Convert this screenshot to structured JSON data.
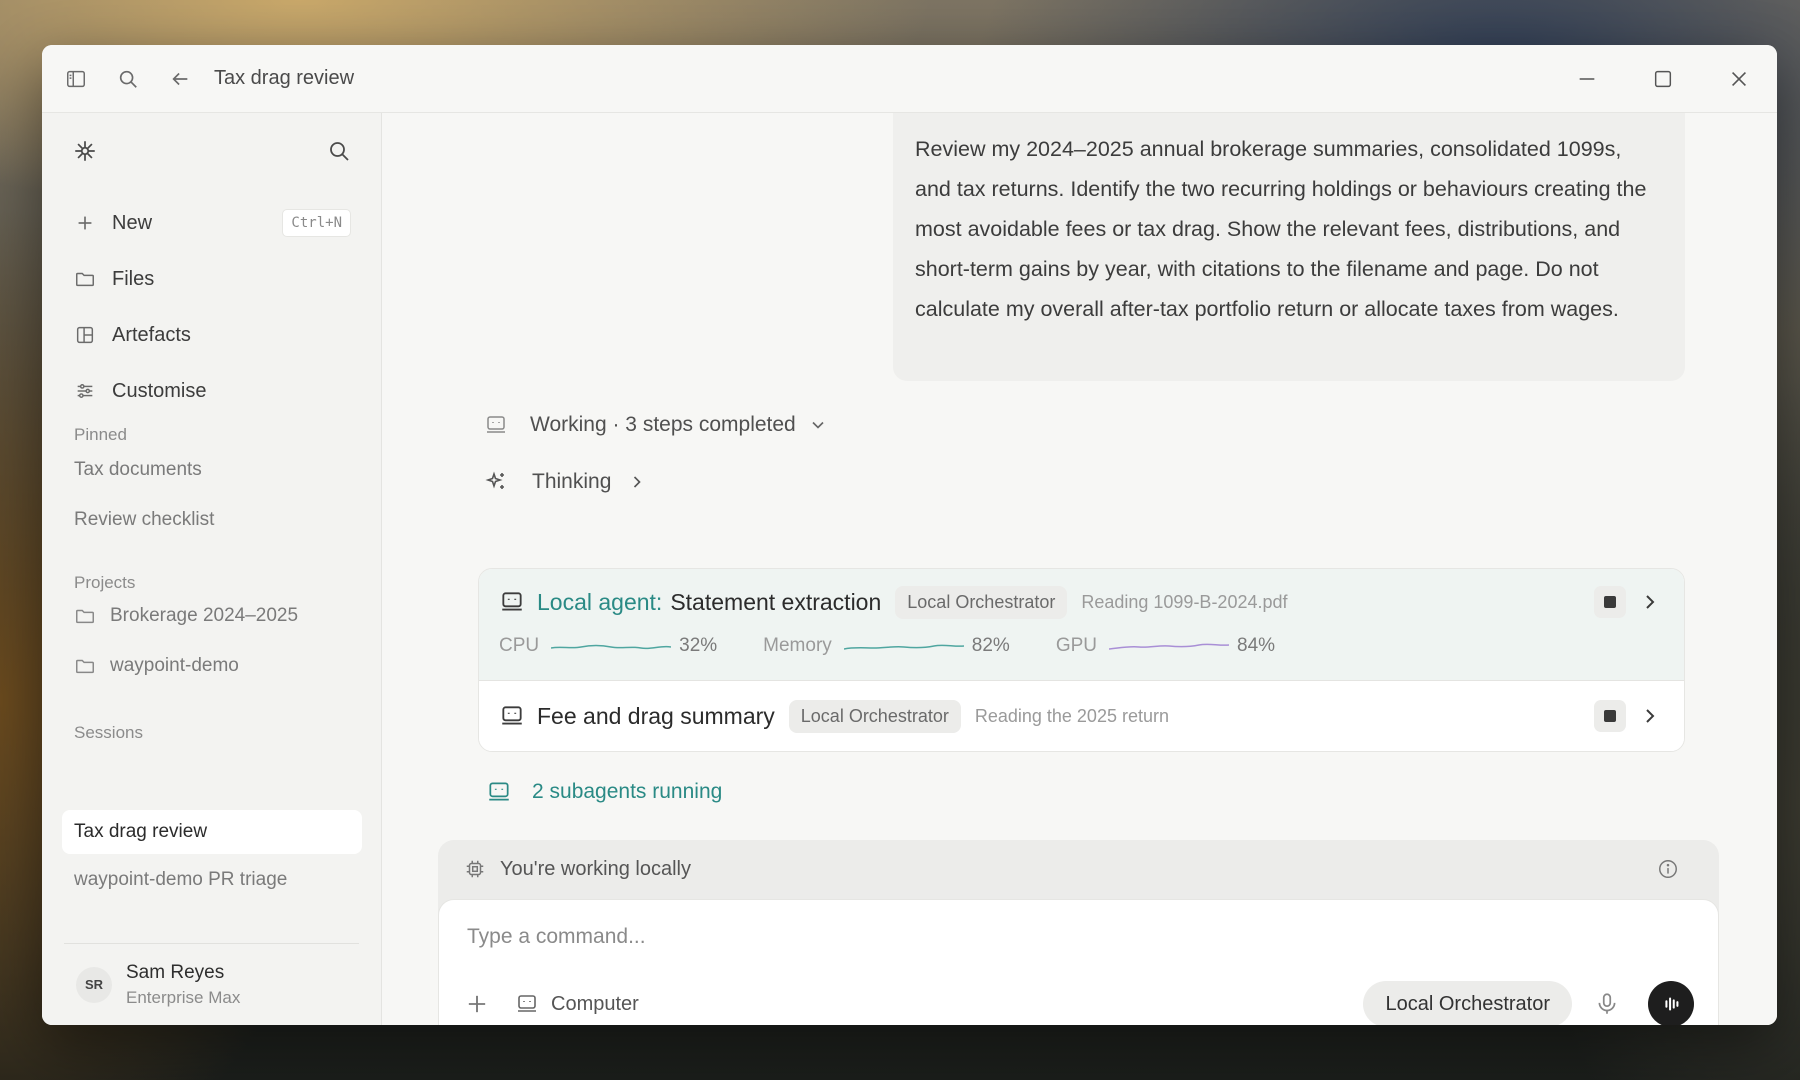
{
  "titlebar": {
    "title": "Tax drag review",
    "icons": [
      "sidebar-toggle-icon",
      "search-icon",
      "back-arrow-icon"
    ],
    "controls": [
      "minimize-icon",
      "maximize-icon",
      "close-icon"
    ]
  },
  "sidebar": {
    "nav": [
      {
        "label": "New",
        "icon": "plus-icon",
        "shortcut": "Ctrl+N"
      },
      {
        "label": "Files",
        "icon": "folder-icon"
      },
      {
        "label": "Artefacts",
        "icon": "artefacts-icon"
      },
      {
        "label": "Customise",
        "icon": "sliders-icon"
      }
    ],
    "pinned_label": "Pinned",
    "pinned": [
      "Tax documents",
      "Review checklist"
    ],
    "projects_label": "Projects",
    "projects": [
      "Brokerage 2024–2025",
      "waypoint-demo"
    ],
    "sessions_label": "Sessions",
    "sessions": [
      "Tax drag review",
      "waypoint-demo PR triage"
    ],
    "user": {
      "initials": "SR",
      "name": "Sam Reyes",
      "plan": "Enterprise Max"
    }
  },
  "main": {
    "user_message": "Review my 2024–2025 annual brokerage summaries, consolidated 1099s, and tax returns. Identify the two recurring holdings or behaviours creating the most avoidable fees or tax drag. Show the relevant fees, distributions, and short-term gains by year, with citations to the filename and page. Do not calculate my overall after-tax portfolio return or allocate taxes from wages.",
    "working_status": "Working · 3 steps completed",
    "thinking_label": "Thinking",
    "tasks": [
      {
        "prefix": "Local agent:",
        "title": "Statement extraction",
        "chip": "Local Orchestrator",
        "status": "Reading 1099-B-2024.pdf",
        "metrics": [
          {
            "label": "CPU",
            "value": "32%",
            "color": "#4fa6a0"
          },
          {
            "label": "Memory",
            "value": "82%",
            "color": "#4fa6a0"
          },
          {
            "label": "GPU",
            "value": "84%",
            "color": "#a98fd6"
          }
        ]
      },
      {
        "title": "Fee and drag summary",
        "chip": "Local Orchestrator",
        "status": "Reading the 2025 return"
      }
    ],
    "subagents": "2 subagents running",
    "local_notice": "You're working locally",
    "composer": {
      "placeholder": "Type a command...",
      "computer_label": "Computer",
      "orchestrator_label": "Local Orchestrator"
    }
  },
  "colors": {
    "accent": "#2a8a85",
    "gpu_line": "#a98fd6",
    "send_button": "#1e1e1e"
  }
}
